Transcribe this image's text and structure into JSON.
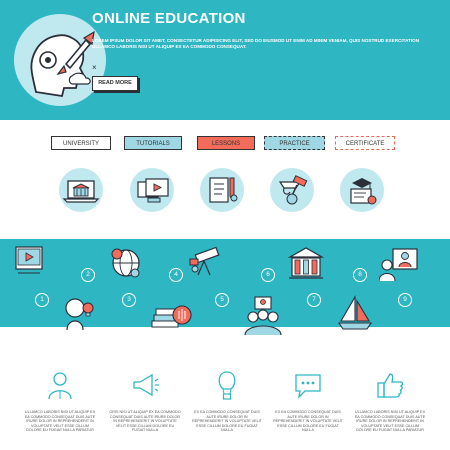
{
  "header": {
    "title": "ONLINE EDUCATION",
    "body": "LOREM IPSUM DOLOR SIT AMET, CONSECTETUR ADIPISICING ELIT, SED DO EIUSMOD UT ENIM AD MINIM VENIAM, QUIS NOSTRUD EXERCITATION ULLAMCO LABORIS NISI UT ALIQUIP EX EA COMMODO CONSEQUAT.",
    "read_more": "READ MORE",
    "accent": "#2fb6c3"
  },
  "tabs": [
    {
      "label": "UNIVERSITY",
      "icon": "university-laptop-icon"
    },
    {
      "label": "TUTORIALS",
      "icon": "video-tutorial-icon"
    },
    {
      "label": "LESSONS",
      "icon": "lesson-checklist-icon"
    },
    {
      "label": "PRACTICE",
      "icon": "practice-tools-icon"
    },
    {
      "label": "CERTIFICATE",
      "icon": "diploma-certificate-icon"
    }
  ],
  "steps": [
    "1",
    "2",
    "3",
    "4",
    "5",
    "6",
    "7",
    "8",
    "9"
  ],
  "features": [
    {
      "icon": "person-icon",
      "text": "ULLAMCO LABORIS NISI UT ALIQUIP EX EA COMMODO CONSEQUAT DUIS AUTE IRURE DOLOR IN REPREHENDERIT IN VOLUPTATE VELIT ESSE CILLUM DOLORE EU FUGIAT NULLA PARIATUR"
    },
    {
      "icon": "megaphone-icon",
      "text": "ORIS NISI UT ALIQUIP EX EA COMMODO CONSEQUAT DUIS AUTE IRURE DOLOR IN REPREHENDERIT IN VOLUPTATE VELIT ESSE CILLUM DOLORE EU FUGIAT NULLA"
    },
    {
      "icon": "hot-air-balloon-icon",
      "text": "EX EA COMMODO CONSEQUAT DUIS AUTE IRURE DOLOR IN REPREHENDERIT IN VOLUPTATE VELIT ESSE CILLUM DOLORE EU FUGIAT NULLA"
    },
    {
      "icon": "chat-bubble-icon",
      "text": "EX EA COMMODO CONSEQUAT DUIS AUTE IRURE DOLOR IN REPREHENDERIT IN VOLUPTATE VELIT ESSE CILLUM DOLORE EU FUGIAT NULLA"
    },
    {
      "icon": "thumbs-up-icon",
      "text": "ULLAMCO LABORIS NISI UT ALIQUIP EX EA COMMODO CONSEQUAT DUIS AUTE IRURE DOLOR IN REPREHENDERIT IN VOLUPTATE VELIT ESSE CILLUM DOLORE EU FUGIAT NULLA PARIATUR"
    }
  ]
}
